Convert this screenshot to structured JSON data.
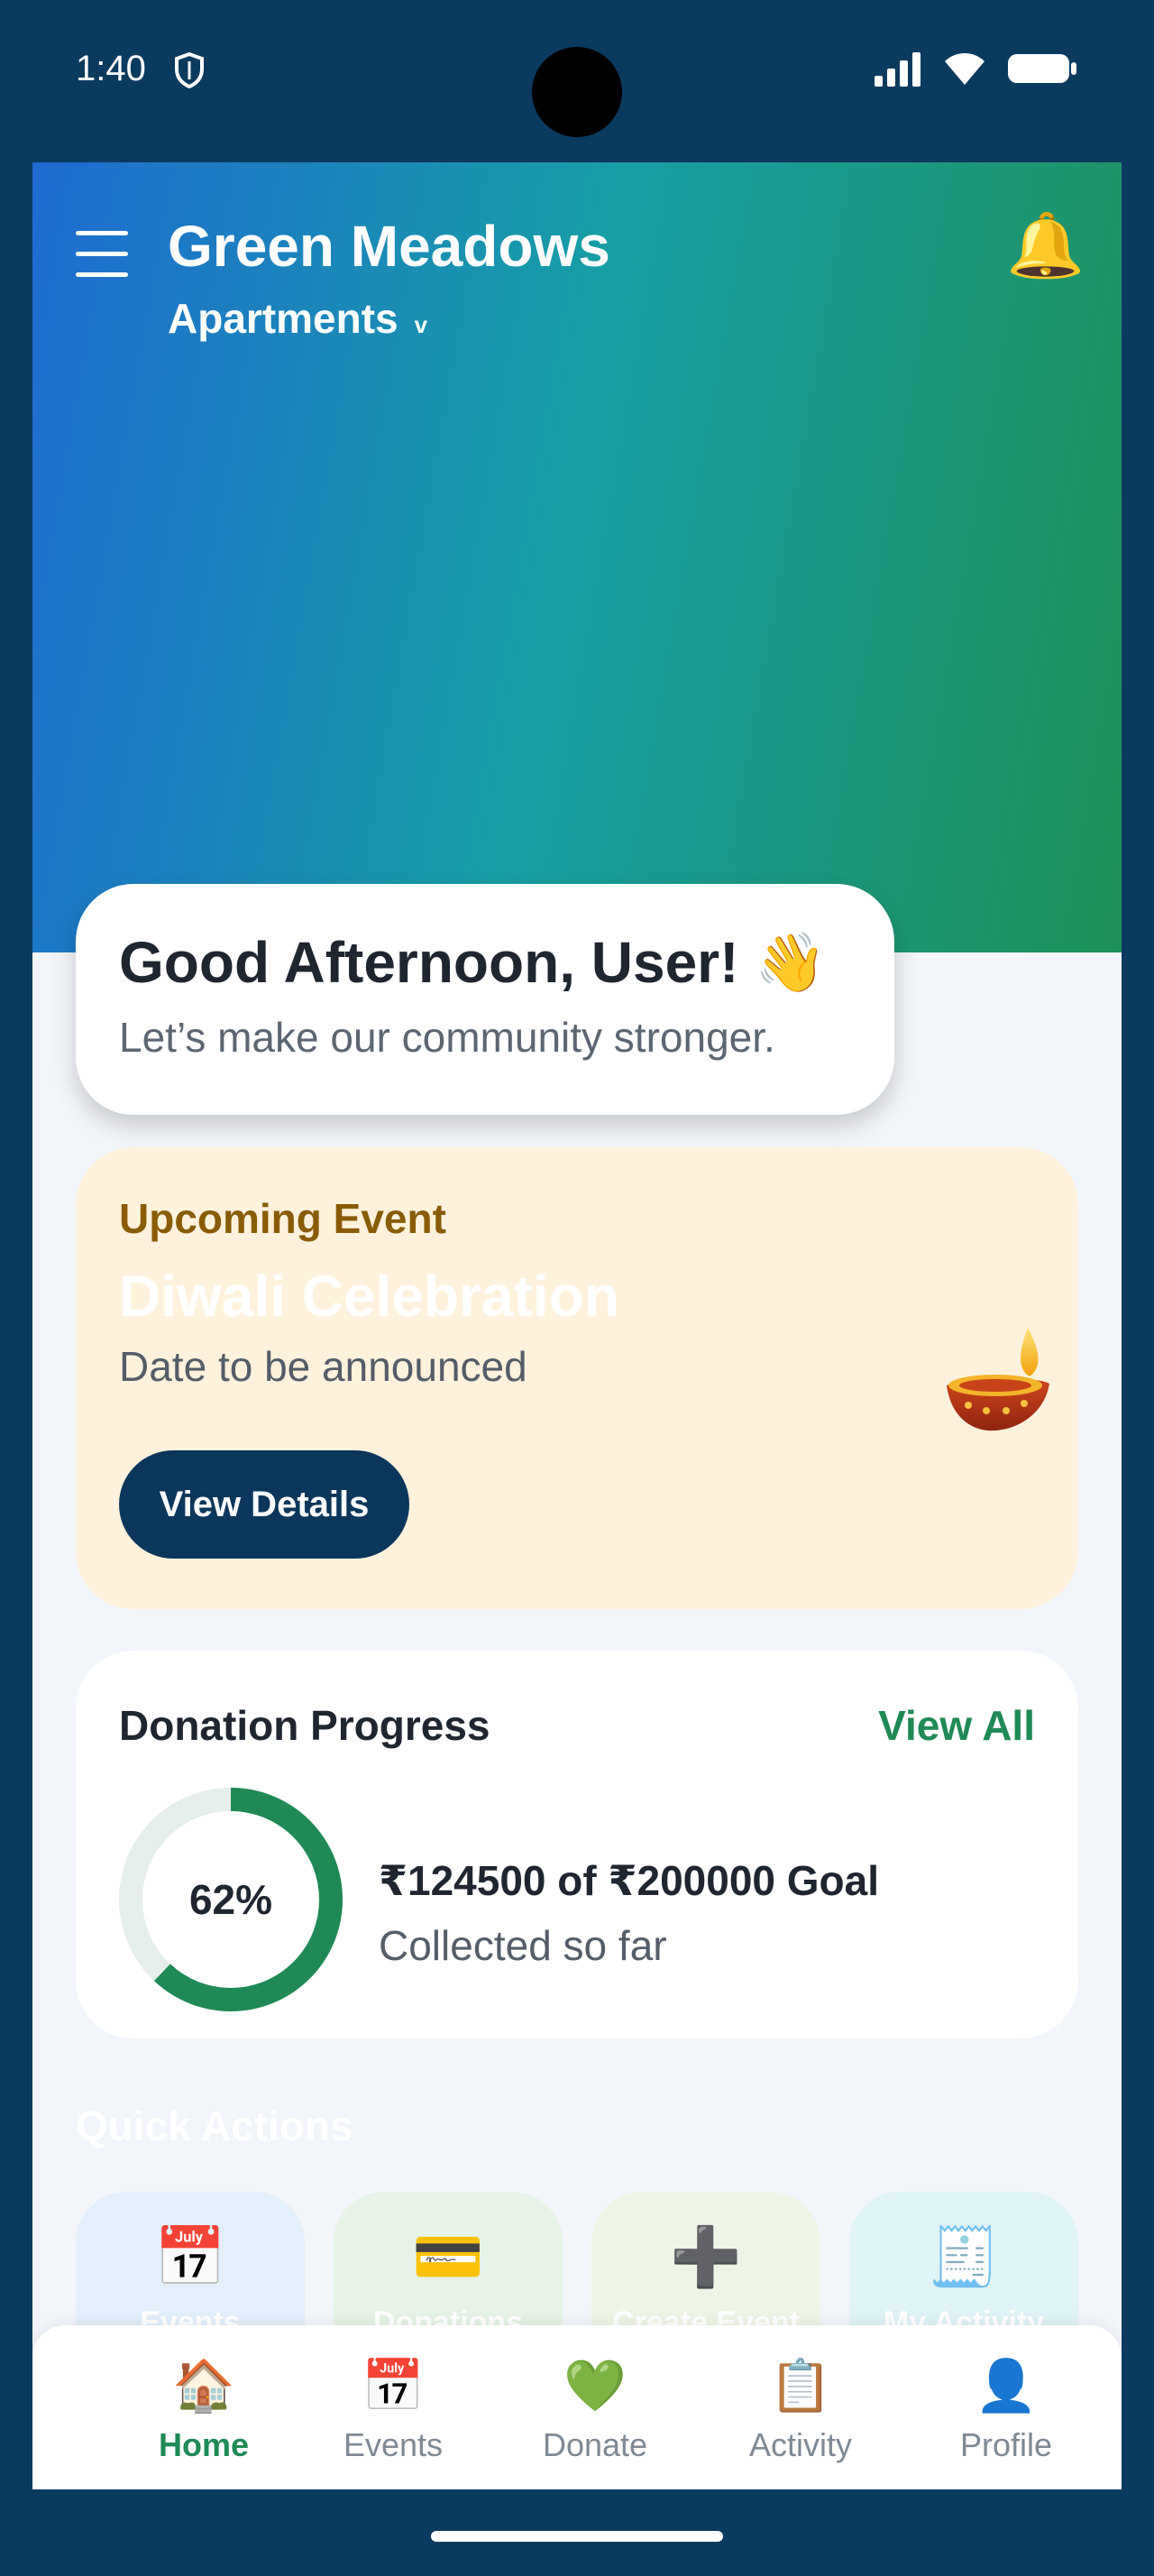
{
  "status_bar": {
    "time": "1:40",
    "icons": [
      "shield-icon",
      "signal-icon",
      "wifi-icon",
      "battery-icon"
    ]
  },
  "header": {
    "title": "Green Meadows",
    "subtitle": "Apartments",
    "dropdown_glyph": "v",
    "menu_icon": "hamburger-menu-icon",
    "bell_icon": "🔔",
    "gradient_colors": [
      "#1f6bd1",
      "#179ea5",
      "#1f9157"
    ]
  },
  "greeting": {
    "title": "Good Afternoon, User! 👋",
    "subtitle": "Let’s make our community stronger."
  },
  "upcoming_event": {
    "label": "Upcoming Event",
    "title": "Diwali Celebration",
    "date": "Date to be announced",
    "button_label": "View Details",
    "icon": "diya-lamp-icon"
  },
  "donation": {
    "title": "Donation Progress",
    "view_all": "View All",
    "progress_percent": 62,
    "progress_label": "62%",
    "amount_text": "₹124500 of ₹200000 Goal",
    "sub_text": "Collected so far",
    "accent": "#1f8a55"
  },
  "quick_actions": {
    "title": "Quick Actions",
    "items": [
      {
        "label": "Events",
        "icon": "📅",
        "bg": "#e3f0fb"
      },
      {
        "label": "Donations",
        "icon": "💳",
        "bg": "#e6f3e6"
      },
      {
        "label": "Create Event",
        "icon": "➕",
        "bg": "#eef5e6"
      },
      {
        "label": "My Activity",
        "icon": "🧾",
        "bg": "#e0f3f6"
      }
    ]
  },
  "bottom_nav": {
    "items": [
      {
        "label": "Home",
        "icon": "🏠",
        "active": true
      },
      {
        "label": "Events",
        "icon": "📅",
        "active": false
      },
      {
        "label": "Donate",
        "icon": "💚",
        "active": false
      },
      {
        "label": "Activity",
        "icon": "📋",
        "active": false
      },
      {
        "label": "Profile",
        "icon": "👤",
        "active": false
      }
    ]
  }
}
